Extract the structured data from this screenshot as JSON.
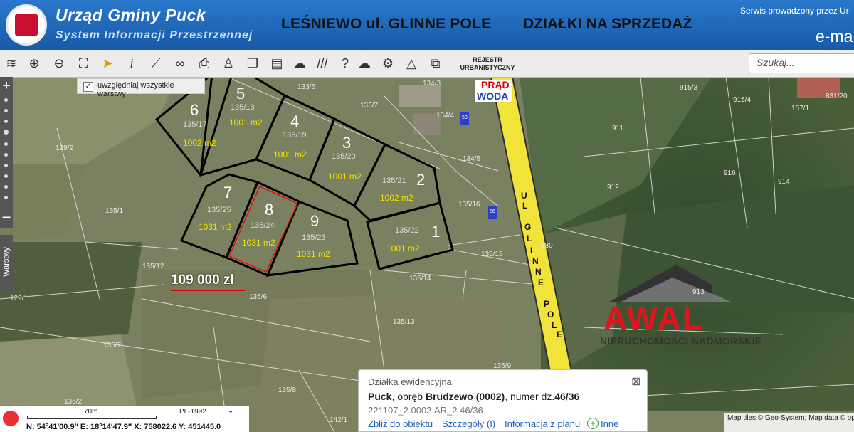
{
  "header": {
    "title": "Urząd Gminy Puck",
    "subtitle": "System Informacji Przestrzennej",
    "heading_location": "LEŚNIEWO ul. GLINNE POLE",
    "heading_offer": "DZIAŁKI  NA SPRZEDAŻ",
    "service_note": "Serwis prowadzony przez Ur",
    "email_label": "e-ma"
  },
  "toolbar": {
    "icons": [
      "layers-icon",
      "zoom-in-icon",
      "zoom-out-icon",
      "zoom-extent-icon",
      "pointer-icon",
      "info-icon",
      "measure-icon",
      "link-icon",
      "print-icon",
      "street-view-icon",
      "copy-icon",
      "layout-icon",
      "draw-area-icon",
      "hatch-icon",
      "help-icon",
      "cloud-icon",
      "settings-icon",
      "triangle-icon",
      "pages-icon"
    ],
    "rejestr_label_1": "REJESTR",
    "rejestr_label_2": "URBANISTYCZNY",
    "search_placeholder": "Szukaj..."
  },
  "layers_option": {
    "label": "uwzględniaj wszystkie warstwy",
    "checked": true
  },
  "side": {
    "warstwy_label": "Warstwy"
  },
  "map": {
    "utilities_power": "PRĄD",
    "utilities_water": "WODA",
    "road_label_letters": [
      "U",
      "L",
      "G",
      "L",
      "I",
      "N",
      "N",
      "E",
      "P",
      "O",
      "L",
      "E"
    ],
    "plots": [
      {
        "number": "6",
        "parcel": "135/17",
        "area": "1002 m2"
      },
      {
        "number": "5",
        "parcel": "135/18",
        "area": "1001 m2"
      },
      {
        "number": "4",
        "parcel": "135/19",
        "area": "1001 m2"
      },
      {
        "number": "3",
        "parcel": "135/20",
        "area": "1001 m2"
      },
      {
        "number": "2",
        "parcel": "135/21",
        "area": "1002 m2"
      },
      {
        "number": "1",
        "parcel": "135/22",
        "area": "1001 m2"
      },
      {
        "number": "7",
        "parcel": "135/25",
        "area": "1031 m2"
      },
      {
        "number": "8",
        "parcel": "135/24",
        "area": "1031 m2"
      },
      {
        "number": "9",
        "parcel": "135/23",
        "area": "1031 m2"
      }
    ],
    "parcel_labels": [
      "133/6",
      "133/7",
      "134/3",
      "134/4",
      "134/5",
      "135/16",
      "135/15",
      "135/14",
      "135/13",
      "135/12",
      "135/1",
      "135/6",
      "135/7",
      "135/8",
      "135/9",
      "129/2",
      "129/1",
      "136/2",
      "142/1",
      "180",
      "911",
      "912",
      "913",
      "914",
      "915/3",
      "915/4",
      "916",
      "157/1",
      "831/20",
      "53",
      "56"
    ],
    "price": "109 000 zł"
  },
  "brand": {
    "name": "AWAL",
    "tagline": "NIERUCHOMOŚCI NADMORSKIE"
  },
  "popup": {
    "title": "Działka ewidencyjna",
    "location_bold": "Puck",
    "location_mid": ", obręb ",
    "precinct_bold": "Brudzewo (0002)",
    "number_prefix": ", numer dz.",
    "number_bold": "46/36",
    "identifier": "221107_2.0002.AR_2.46/36",
    "link_zoom": "Zbliż do obiektu",
    "link_details": "Szczegóły (I)",
    "link_plan": "Informacja z planu",
    "link_other": "Inne"
  },
  "status": {
    "scale_label": "70m",
    "crs": "PL-1992",
    "coords": "N: 54°41′00.9″  E: 18°14′47.9″  X: 758022.6  Y: 451445.0",
    "attribution": "Map tiles © Geo-System; Map data © openstreetmap"
  },
  "colors": {
    "header": "#1e63b4",
    "road": "#f2e33a",
    "plot_outline": "#000000",
    "plot_area_text": "#f5e000",
    "accent_red": "#e0141e"
  }
}
